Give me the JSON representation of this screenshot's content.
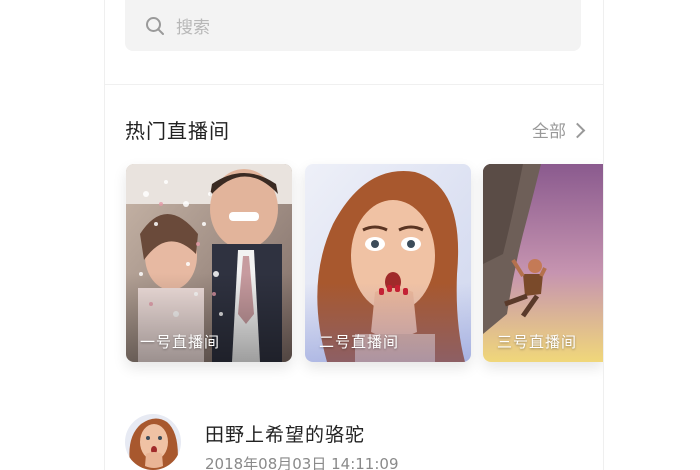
{
  "search": {
    "placeholder": "搜索",
    "icon": "search-icon"
  },
  "hot_section": {
    "title": "热门直播间",
    "see_all_label": "全部",
    "see_all_icon": "chevron-right-icon"
  },
  "rooms": [
    {
      "label": "一号直播间"
    },
    {
      "label": "二号直播间"
    },
    {
      "label": "三号直播间"
    }
  ],
  "list": [
    {
      "title": "田野上希望的骆驼",
      "time": "2018年08月03日  14:11:09"
    }
  ],
  "colors": {
    "text_primary": "#222222",
    "text_secondary": "#8a8a8a",
    "search_bg": "#f3f3f3"
  }
}
